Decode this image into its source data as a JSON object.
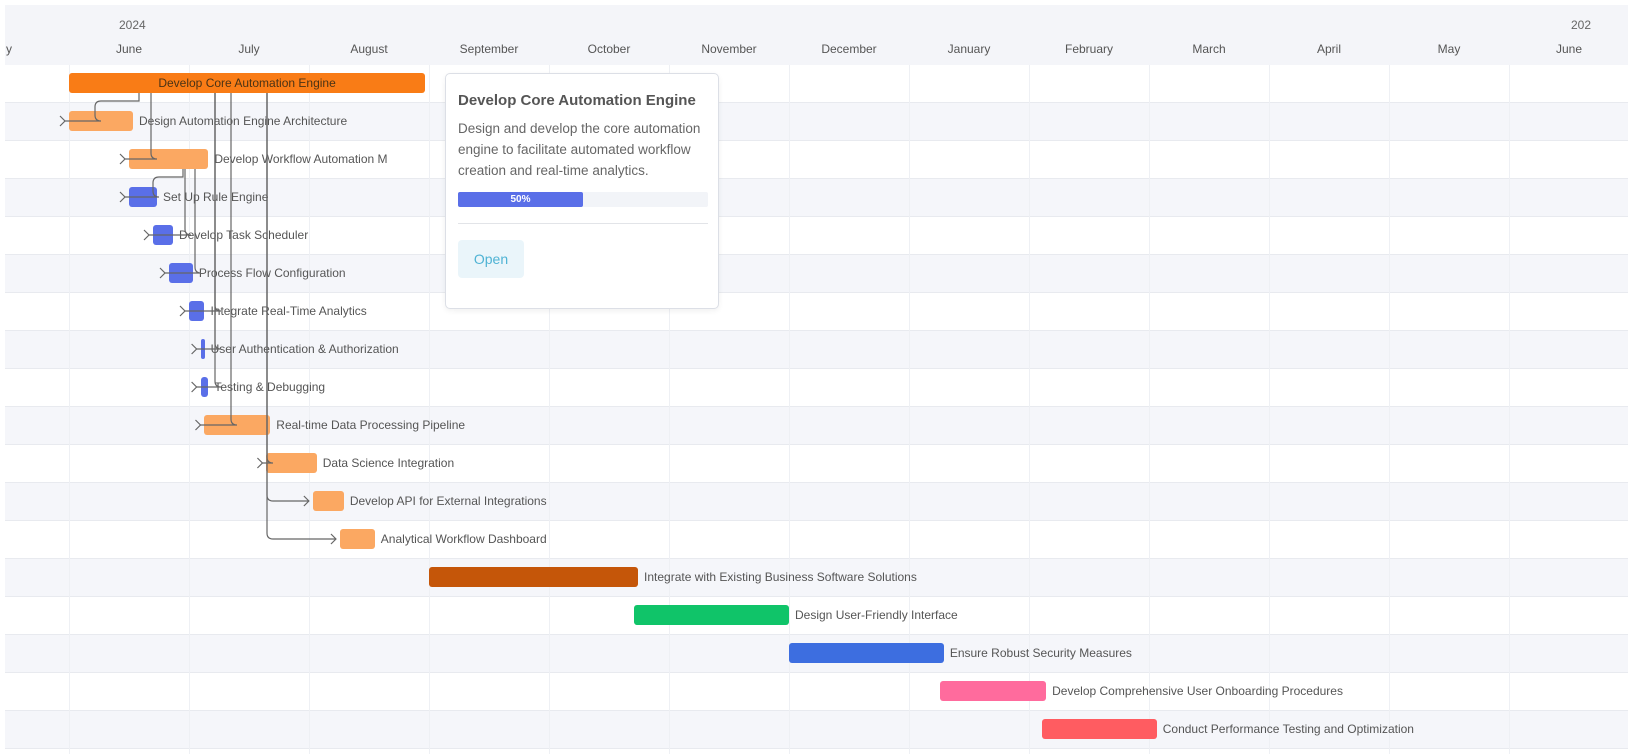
{
  "timeline": {
    "years": [
      "2024",
      "202"
    ],
    "months": [
      "y",
      "June",
      "July",
      "August",
      "September",
      "October",
      "November",
      "December",
      "January",
      "February",
      "March",
      "April",
      "May",
      "June"
    ]
  },
  "tasks": [
    {
      "name": "Develop Core Automation Engine",
      "start": "2024-06-01",
      "end": "2024-08-31",
      "color": "#f97c16"
    },
    {
      "name": "Design Automation Engine Architecture",
      "start": "2024-06-01",
      "end": "2024-06-17",
      "color": "#fba862"
    },
    {
      "name": "Develop Workflow Automation M",
      "start": "2024-06-16",
      "end": "2024-07-06",
      "color": "#fba862"
    },
    {
      "name": "Set Up Rule Engine",
      "start": "2024-06-16",
      "end": "2024-06-23",
      "color": "#5a6fe8"
    },
    {
      "name": "Develop Task Scheduler",
      "start": "2024-06-22",
      "end": "2024-06-27",
      "color": "#5a6fe8"
    },
    {
      "name": "Process Flow Configuration",
      "start": "2024-06-26",
      "end": "2024-07-02",
      "color": "#5a6fe8"
    },
    {
      "name": "Integrate Real-Time Analytics",
      "start": "2024-07-01",
      "end": "2024-07-05",
      "color": "#5a6fe8"
    },
    {
      "name": "User Authentication & Authorization",
      "start": "2024-07-04",
      "end": "2024-07-05",
      "color": "#5a6fe8"
    },
    {
      "name": "Testing & Debugging",
      "start": "2024-07-04",
      "end": "2024-07-06",
      "color": "#5a6fe8"
    },
    {
      "name": "Real-time Data Processing Pipeline",
      "start": "2024-07-05",
      "end": "2024-07-22",
      "color": "#fba862"
    },
    {
      "name": "Data Science Integration",
      "start": "2024-07-21",
      "end": "2024-08-03",
      "color": "#fba862"
    },
    {
      "name": "Develop API for External Integrations",
      "start": "2024-08-02",
      "end": "2024-08-10",
      "color": "#fba862"
    },
    {
      "name": "Analytical Workflow Dashboard",
      "start": "2024-08-09",
      "end": "2024-08-18",
      "color": "#fba862"
    },
    {
      "name": "Integrate with Existing Business Software Solutions",
      "start": "2024-09-01",
      "end": "2024-10-24",
      "color": "#c55609"
    },
    {
      "name": "Design User-Friendly Interface",
      "start": "2024-10-23",
      "end": "2024-12-01",
      "color": "#10c469"
    },
    {
      "name": "Ensure Robust Security Measures",
      "start": "2024-12-01",
      "end": "2025-01-10",
      "color": "#3d6ee0"
    },
    {
      "name": "Develop Comprehensive User Onboarding Procedures",
      "start": "2025-01-09",
      "end": "2025-02-05",
      "color": "#ff6b9d"
    },
    {
      "name": "Conduct Performance Testing and Optimization",
      "start": "2025-02-04",
      "end": "2025-03-03",
      "color": "#ff5c61"
    }
  ],
  "popup": {
    "title": "Develop Core Automation Engine",
    "description": "Design and develop the core automation engine to facilitate automated workflow creation and real-time analytics.",
    "progress": 0.5,
    "progress_label": "50%",
    "button_label": "Open"
  }
}
